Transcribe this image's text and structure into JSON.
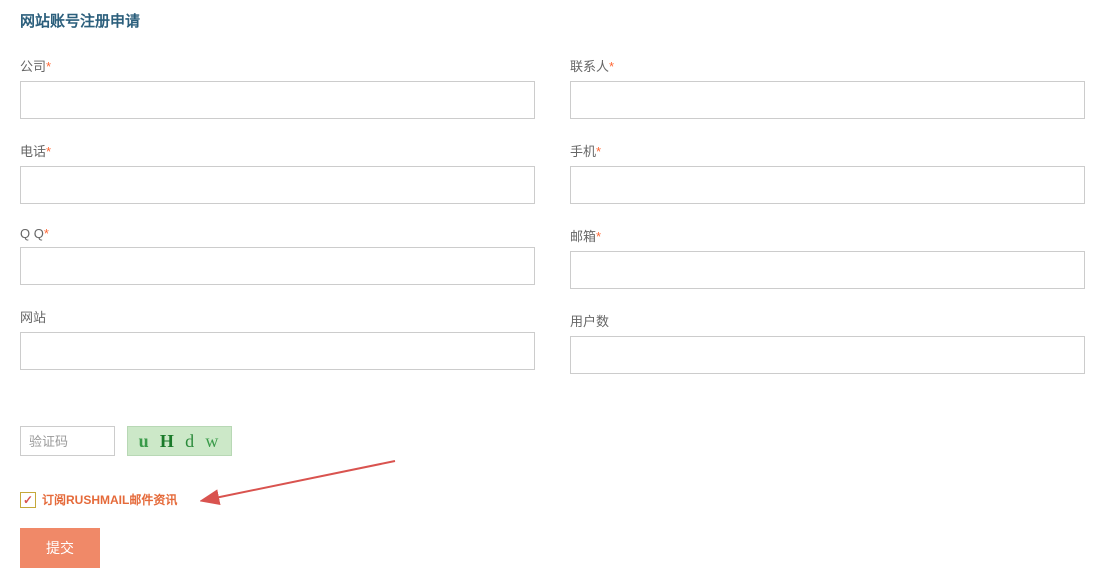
{
  "page_title": "网站账号注册申请",
  "form": {
    "company": {
      "label": "公司",
      "required": "*",
      "value": ""
    },
    "contact": {
      "label": "联系人",
      "required": "*",
      "value": ""
    },
    "phone": {
      "label": "电话",
      "required": "*",
      "value": ""
    },
    "mobile": {
      "label": "手机",
      "required": "*",
      "value": ""
    },
    "qq": {
      "label": "Q Q",
      "required": "*",
      "value": ""
    },
    "email": {
      "label": "邮箱",
      "required": "*",
      "value": ""
    },
    "website": {
      "label": "网站",
      "required": "",
      "value": ""
    },
    "users": {
      "label": "用户数",
      "required": "",
      "value": ""
    }
  },
  "captcha": {
    "placeholder": "验证码",
    "chars": [
      "u",
      "H",
      "d",
      "w"
    ]
  },
  "subscribe": {
    "checked": true,
    "label": "订阅RUSHMAIL邮件资讯"
  },
  "submit_label": "提交"
}
